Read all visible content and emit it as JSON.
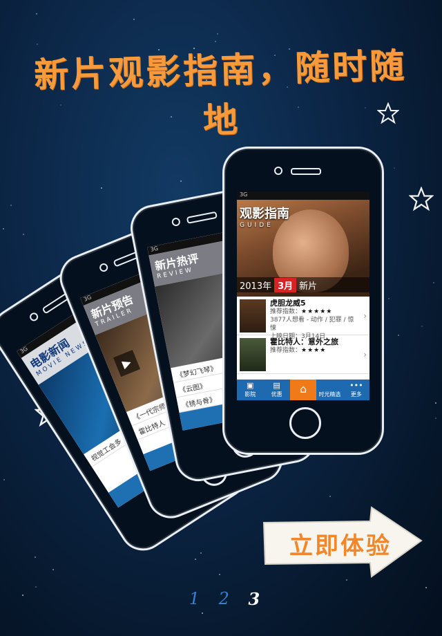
{
  "headline": "新片观影指南，随时随地",
  "phones": {
    "news": {
      "title": "电影新闻",
      "subtitle": "MOVIE NEWS",
      "row1": "视觉工会多",
      "status": "3G"
    },
    "trailer": {
      "title": "新片预告",
      "subtitle": "TRAILER",
      "row1": "《一代宗师》",
      "row2": "霍比特人",
      "status": "3G"
    },
    "review": {
      "title": "新片热评",
      "subtitle": "REVIEW",
      "row1": "《梦幻飞琴》",
      "row2": "《云图》",
      "row3": "《锈与骨》",
      "status": "3G"
    },
    "main": {
      "status": "3G",
      "brand": "观影指南",
      "brand_sub": "GUIDE",
      "year": "2013年",
      "month": "3月",
      "new_label": "新片",
      "films": [
        {
          "title": "虎胆龙威5",
          "rating_label": "推荐指数：",
          "stars": "★★★★★",
          "meta": "3877人想看 - 动作 / 犯罪 / 惊悚",
          "release": "上映日期：3月14日"
        },
        {
          "title": "霍比特人：意外之旅",
          "rating_label": "推荐指数：",
          "stars": "★★★★",
          "meta": "",
          "release": ""
        }
      ],
      "tabs": [
        {
          "icon": "film-icon",
          "label": "影院"
        },
        {
          "icon": "ticket-icon",
          "label": "优惠"
        },
        {
          "icon": "home-icon",
          "label": ""
        },
        {
          "icon": "clock-icon",
          "label": "时光精选"
        },
        {
          "icon": "more-icon",
          "label": "更多"
        }
      ]
    }
  },
  "cta": {
    "label": "立即体验"
  },
  "pager": {
    "pages": [
      "1",
      "2",
      "3"
    ],
    "current": "3"
  },
  "colors": {
    "accent": "#f1862a",
    "pager_blue": "#3a7fd0",
    "tab_blue": "#1d6ab0",
    "tab_active": "#f07a18"
  }
}
